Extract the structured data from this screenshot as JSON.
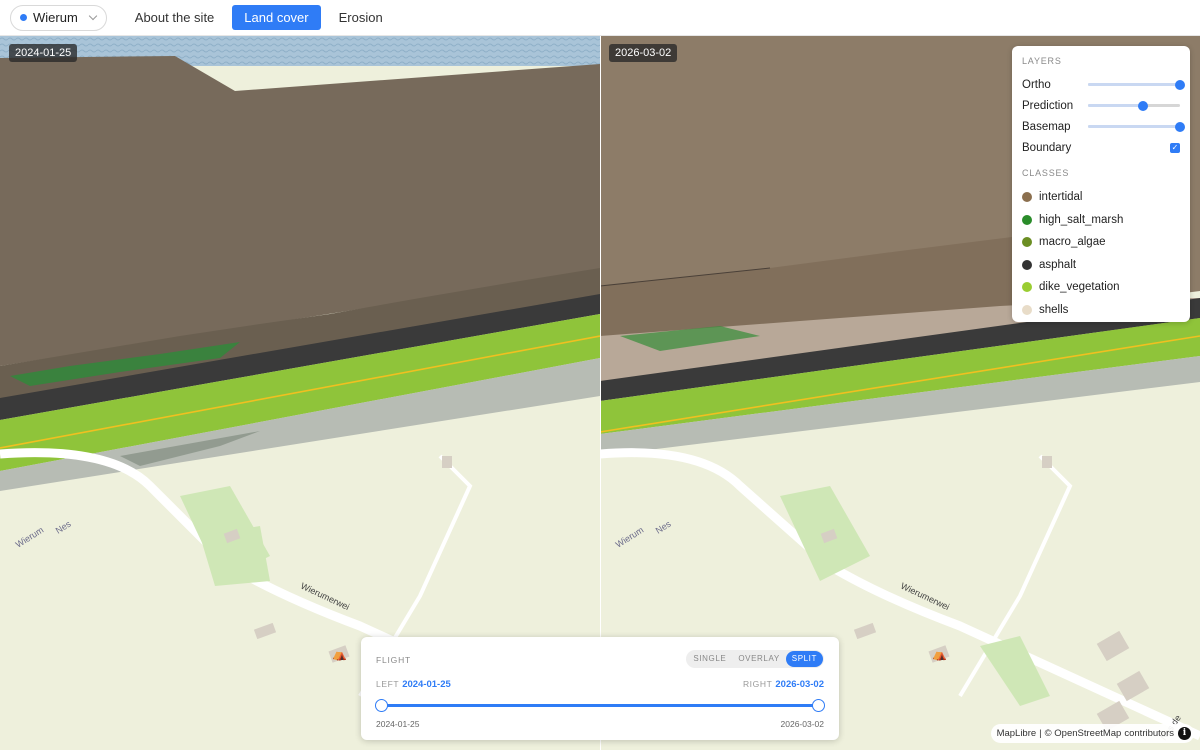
{
  "header": {
    "site_name": "Wierum",
    "tabs": [
      {
        "label": "About the site",
        "active": false
      },
      {
        "label": "Land cover",
        "active": true
      },
      {
        "label": "Erosion",
        "active": false
      }
    ]
  },
  "map": {
    "left_date": "2024-01-25",
    "right_date": "2026-03-02",
    "place_labels": [
      "Wierum",
      "Nes"
    ],
    "road_label": "Wierumerwei",
    "road_label_partial": "Nes de"
  },
  "layers_panel": {
    "layers_heading": "LAYERS",
    "layers": [
      {
        "name": "Ortho",
        "opacity": 1.0
      },
      {
        "name": "Prediction",
        "opacity": 0.6
      },
      {
        "name": "Basemap",
        "opacity": 1.0
      }
    ],
    "boundary_label": "Boundary",
    "boundary_checked": true,
    "classes_heading": "CLASSES",
    "classes": [
      {
        "name": "intertidal",
        "color": "#8b6f4e"
      },
      {
        "name": "high_salt_marsh",
        "color": "#2a8c2a"
      },
      {
        "name": "macro_algae",
        "color": "#6b8e23"
      },
      {
        "name": "asphalt",
        "color": "#333333"
      },
      {
        "name": "dike_vegetation",
        "color": "#9acd32"
      },
      {
        "name": "shells",
        "color": "#e8dcc8"
      }
    ]
  },
  "flight_panel": {
    "heading": "FLIGHT",
    "modes": [
      {
        "label": "SINGLE",
        "active": false
      },
      {
        "label": "OVERLAY",
        "active": false
      },
      {
        "label": "SPLIT",
        "active": true
      }
    ],
    "left_label": "LEFT",
    "left_date": "2024-01-25",
    "right_label": "RIGHT",
    "right_date": "2026-03-02",
    "range_min": "2024-01-25",
    "range_max": "2026-03-02"
  },
  "attribution": {
    "maplibre": "MapLibre",
    "separator": "|",
    "osm": "© OpenStreetMap",
    "contributors": "contributors"
  },
  "colors": {
    "accent": "#2f7cf6",
    "intertidal_ortho": "#7a6b5a",
    "water": "#a9c6dd",
    "dike_green": "#8fc43a",
    "basemap": "#eef0dc"
  }
}
